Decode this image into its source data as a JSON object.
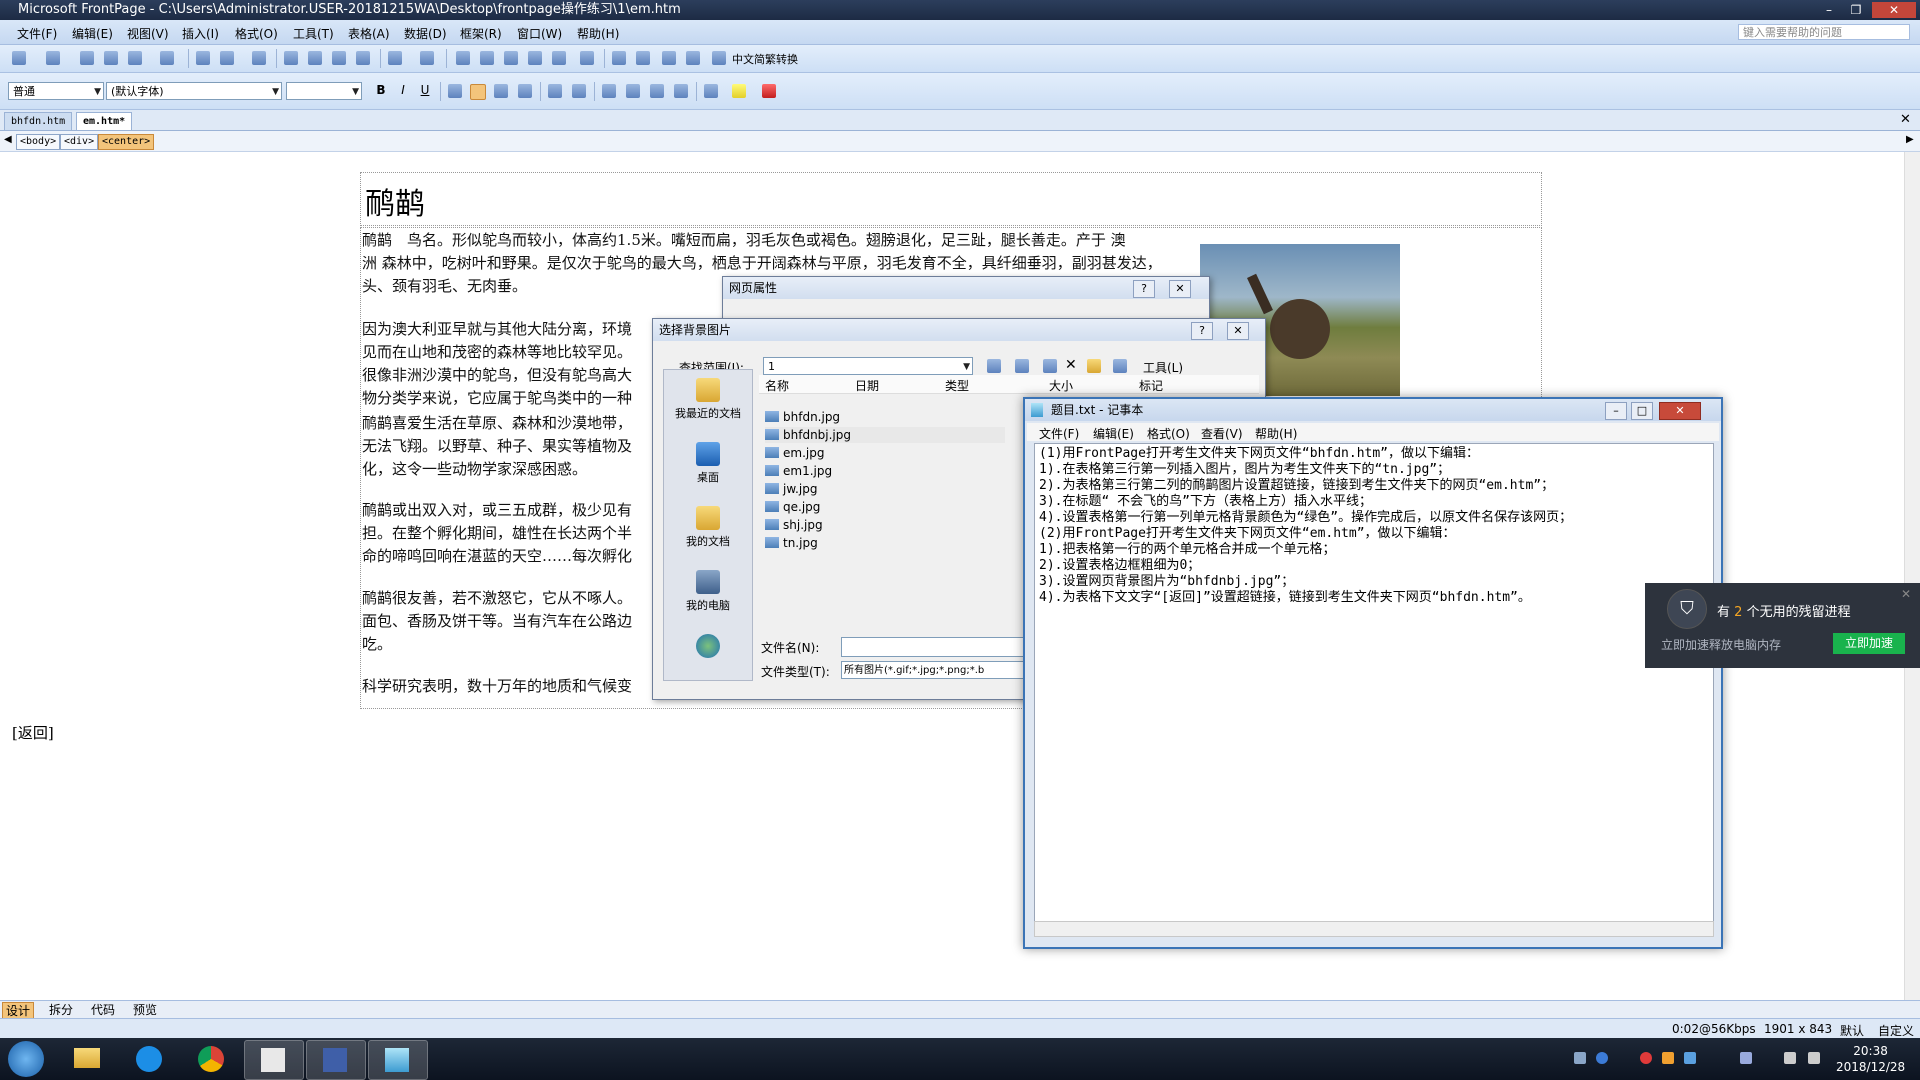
{
  "window": {
    "title": "Microsoft FrontPage - C:\\Users\\Administrator.USER-20181215WA\\Desktop\\frontpage操作练习\\1\\em.htm"
  },
  "menubar": {
    "items": [
      "文件(F)",
      "编辑(E)",
      "视图(V)",
      "插入(I)",
      "格式(O)",
      "工具(T)",
      "表格(A)",
      "数据(D)",
      "框架(R)",
      "窗口(W)",
      "帮助(H)"
    ],
    "help_placeholder": "键入需要帮助的问题"
  },
  "toolbar": {
    "convert_label": "中文简繁转换"
  },
  "format_bar": {
    "style": "普通",
    "font": "(默认字体)",
    "size": "",
    "bold": "B",
    "italic": "I",
    "underline": "U"
  },
  "tabs": [
    "bhfdn.htm",
    "em.htm*"
  ],
  "tag_selector": [
    "<body>",
    "<div>",
    "<center>"
  ],
  "document": {
    "heading": "鸸鹋",
    "paragraphs": [
      [
        "鸸鹋　鸟名。形似鸵鸟而较小，体高约1.5米。嘴短而扁，羽毛灰色或褐色。翅膀退化，足三趾，腿长善走。产于 澳",
        "洲 森林中，吃树叶和野果。是仅次于鸵鸟的最大鸟，栖息于开阔森林与平原，羽毛发育不全，具纤细垂羽，副羽甚发达，",
        "头、颈有羽毛、无肉垂。"
      ],
      [
        "因为澳大利亚早就与其他大陆分离，环境",
        "见而在山地和茂密的森林等地比较罕见。",
        "很像非洲沙漠中的鸵鸟，但没有鸵鸟高大",
        "物分类学来说，它应属于鸵鸟类中的一种"
      ],
      [
        "鸸鹋喜爱生活在草原、森林和沙漠地带，",
        "无法飞翔。以野草、种子、果实等植物及",
        "化，这令一些动物学家深感困惑。"
      ],
      [
        "鸸鹋或出双入对，或三五成群，极少见有",
        "担。在整个孵化期间，雄性在长达两个半",
        "命的啼鸣回响在湛蓝的天空……每次孵化"
      ],
      [
        "鸸鹋很友善，若不激怒它，它从不啄人。",
        "面包、香肠及饼干等。当有汽车在公路边",
        "吃。"
      ],
      [
        "科学研究表明，数十万年的地质和气候变"
      ]
    ],
    "back_link": "[返回]"
  },
  "view_tabs": [
    "设计",
    "拆分",
    "代码",
    "预览"
  ],
  "status": {
    "speed": "0:02@56Kbps",
    "dimensions": "1901 x 843",
    "mode": "默认",
    "custom": "自定义"
  },
  "page_props_dialog": {
    "title": "网页属性"
  },
  "bg_dialog": {
    "title": "选择背景图片",
    "lookin_label": "查找范围(I):",
    "lookin_value": "1",
    "tools_label": "工具(L)",
    "columns": [
      "名称",
      "日期",
      "类型",
      "大小",
      "标记"
    ],
    "places": [
      "我最近的文档",
      "桌面",
      "我的文档",
      "我的电脑"
    ],
    "files": [
      "bhfdn.jpg",
      "bhfdnbj.jpg",
      "em.jpg",
      "em1.jpg",
      "jw.jpg",
      "qe.jpg",
      "shj.jpg",
      "tn.jpg"
    ],
    "filename_label": "文件名(N):",
    "filetype_label": "文件类型(T):",
    "filetype_value": "所有图片(*.gif;*.jpg;*.png;*.b"
  },
  "notepad": {
    "title": "题目.txt - 记事本",
    "menu": [
      "文件(F)",
      "编辑(E)",
      "格式(O)",
      "查看(V)",
      "帮助(H)"
    ],
    "lines": [
      "(1)用FrontPage打开考生文件夹下网页文件“bhfdn.htm”，做以下编辑：",
      "1).在表格第三行第一列插入图片，图片为考生文件夹下的“tn.jpg”；",
      "2).为表格第三行第二列的鸸鹋图片设置超链接，链接到考生文件夹下的网页“em.htm”；",
      "3).在标题“ 不会飞的鸟”下方（表格上方）插入水平线；",
      "4).设置表格第一行第一列单元格背景颜色为“绿色”。操作完成后，以原文件名保存该网页；",
      "(2)用FrontPage打开考生文件夹下网页文件“em.htm”，做以下编辑：",
      "1).把表格第一行的两个单元格合并成一个单元格；",
      "2).设置表格边框粗细为0；",
      "3).设置网页背景图片为“bhfdnbj.jpg”；",
      "4).为表格下文文字“[返回]”设置超链接，链接到考生文件夹下网页“bhfdn.htm”。"
    ]
  },
  "toast": {
    "msg_prefix": "有",
    "count": "2",
    "msg_suffix": "个无用的残留进程",
    "sub": "立即加速释放电脑内存",
    "button": "立即加速"
  },
  "clock": {
    "time": "20:38",
    "date": "2018/12/28"
  }
}
